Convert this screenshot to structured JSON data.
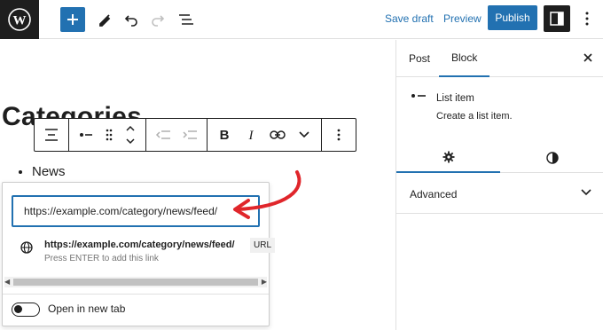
{
  "topbar": {
    "save_draft": "Save draft",
    "preview": "Preview",
    "publish": "Publish"
  },
  "editor": {
    "heading": "Categories",
    "list_items": [
      "News"
    ]
  },
  "link_popover": {
    "url_value": "https://example.com/category/news/feed/",
    "suggestion_title": "https://example.com/category/news/feed/",
    "suggestion_hint": "Press ENTER to add this link",
    "suggestion_type": "URL",
    "open_new_tab_label": "Open in new tab"
  },
  "sidebar": {
    "tabs": [
      {
        "label": "Post"
      },
      {
        "label": "Block"
      }
    ],
    "active_tab": "Block",
    "block": {
      "title": "List item",
      "description": "Create a list item."
    },
    "advanced_label": "Advanced"
  },
  "colors": {
    "accent": "#2271b1",
    "dark": "#1e1e1e",
    "annotation_arrow": "#e0262b"
  }
}
